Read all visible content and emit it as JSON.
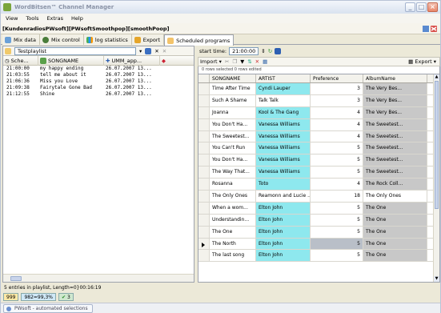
{
  "window": {
    "title": "WordBitsen™ Channel Manager",
    "buttons": [
      "_",
      "□",
      "×"
    ]
  },
  "menu": [
    "View",
    "Tools",
    "Extras",
    "Help"
  ],
  "path": "[KundenradiosPWsoft][PWsoftSmoothpop][smoothPoop]",
  "tabs": [
    {
      "label": "Mix data"
    },
    {
      "label": "Mix control"
    },
    {
      "label": "log statistics"
    },
    {
      "label": "Export"
    },
    {
      "label": "Scheduled programs"
    }
  ],
  "left": {
    "playlist_label": "Testplaylist",
    "headers": [
      "Sche...",
      "SONGNAME",
      "UMM_app..."
    ],
    "rows": [
      {
        "time": "21:00:00",
        "song": "my happy ending",
        "date": "26.07.2007 13..."
      },
      {
        "time": "21:03:55",
        "song": "tell me about it",
        "date": "26.07.2007 13..."
      },
      {
        "time": "21:06:36",
        "song": "Miss you Love",
        "date": "26.07.2007 13..."
      },
      {
        "time": "21:09:38",
        "song": "Fairytale Gone Bad",
        "date": "26.07.2007 13..."
      },
      {
        "time": "21:12:55",
        "song": "Shine",
        "date": "26.07.2007 13..."
      }
    ]
  },
  "right": {
    "start_label": "start time:",
    "start_time": "21:00:00",
    "import_label": "Import",
    "export_label": "Export",
    "selection_info": "0 rows selected  0 rows edited",
    "headers": [
      "SONGNAME",
      "ARTIST",
      "Preference",
      "AlbumName"
    ],
    "rows": [
      {
        "song": "Time After Time",
        "artist": "Cyndi Lauper",
        "pref": "3",
        "album": "The Very Bes..."
      },
      {
        "song": "Such A Shame",
        "artist": "Talk Talk",
        "pref": "3",
        "album": "The Very Bes..."
      },
      {
        "song": "Joanna",
        "artist": "Kool & The Gang",
        "pref": "4",
        "album": "The Very Bes..."
      },
      {
        "song": "You Don't Ha...",
        "artist": "Vanessa Williams",
        "pref": "4",
        "album": "The Sweetest..."
      },
      {
        "song": "The Sweetest...",
        "artist": "Vanessa Williams",
        "pref": "4",
        "album": "The Sweetest..."
      },
      {
        "song": "You Can't Run",
        "artist": "Vanessa Williams",
        "pref": "5",
        "album": "The Sweetest..."
      },
      {
        "song": "You Don't Ha...",
        "artist": "Vanessa Williams",
        "pref": "5",
        "album": "The Sweetest..."
      },
      {
        "song": "The Way That...",
        "artist": "Vanessa Williams",
        "pref": "5",
        "album": "The Sweetest..."
      },
      {
        "song": "Rosanna",
        "artist": "Toto",
        "pref": "4",
        "album": "The Rock Coll..."
      },
      {
        "song": "The Only Ones",
        "artist": "Reamonn and Lucie ...",
        "pref": "18",
        "album": "The Only Ones"
      },
      {
        "song": "When a wom...",
        "artist": "Elton John",
        "pref": "5",
        "album": "The One"
      },
      {
        "song": "Understandin...",
        "artist": "Elton John",
        "pref": "5",
        "album": "The One"
      },
      {
        "song": "The One",
        "artist": "Elton John",
        "pref": "5",
        "album": "The One"
      },
      {
        "song": "The North",
        "artist": "Elton John",
        "pref": "5",
        "album": "The One"
      },
      {
        "song": "The last song",
        "artist": "Elton John",
        "pref": "5",
        "album": "The One"
      }
    ]
  },
  "status": {
    "entries": "5 entries in playlist, Length=0}00:16:19",
    "count": "999",
    "percent": "982=99,3%",
    "ok": "3"
  },
  "taskbar": {
    "task": "PWsoft - automated selections"
  },
  "colors": {
    "artist_highlight": "#8ee8ee",
    "album_highlight": "#c8c8c8",
    "selected_pref": "#b9bfc8"
  }
}
